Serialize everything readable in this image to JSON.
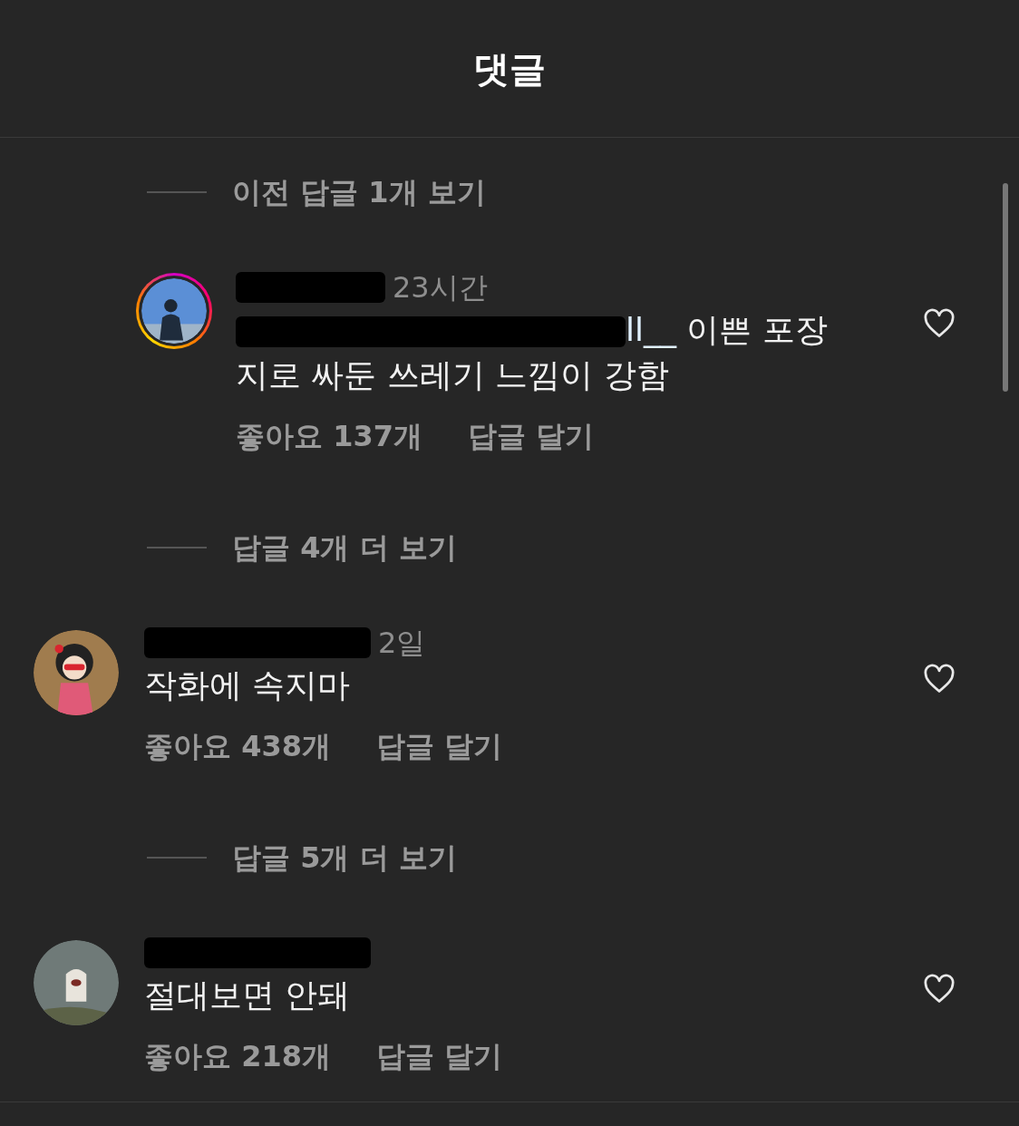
{
  "header": {
    "title": "댓글"
  },
  "items": [
    {
      "kind": "view_replies",
      "label": "이전 답글 1개 보기"
    },
    {
      "kind": "reply",
      "story_ring": true,
      "time": "23시간",
      "mention": "ll__",
      "text": "이쁜 포장지로 싸둔 쓰레기 느낌이 강함",
      "likes": "좋아요 137개",
      "reply_label": "답글 달기",
      "liked": false
    },
    {
      "kind": "view_replies",
      "label": "답글 4개 더 보기"
    },
    {
      "kind": "comment",
      "story_ring": false,
      "time": "2일",
      "text": "작화에 속지마",
      "likes": "좋아요 438개",
      "reply_label": "답글 달기",
      "liked": false
    },
    {
      "kind": "view_replies",
      "label": "답글 5개 더 보기"
    },
    {
      "kind": "comment",
      "story_ring": false,
      "text": "절대보면 안돼",
      "likes": "좋아요 218개",
      "reply_label": "답글 달기",
      "liked": false
    }
  ]
}
